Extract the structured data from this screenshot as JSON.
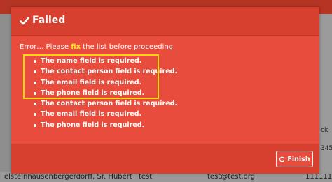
{
  "background": {
    "right_texts": [
      "ck",
      "345",
      "1111"
    ],
    "row": {
      "name": "elsteinhausenbergerdorff, Sr. Hubert",
      "user": "test",
      "email": "test@test.org",
      "phone": "1111111"
    }
  },
  "dialog": {
    "title": "Failed",
    "title_icon": "check-icon",
    "message_before": "Error… Please ",
    "message_highlight": "fix",
    "message_after": " the list before proceeding",
    "errors": [
      "The name field is required.",
      "The contact person field is required.",
      "The email field is required.",
      "The phone field is required.",
      "The contact person field is required.",
      "The email field is required.",
      "The phone field is required."
    ],
    "finish_label": "Finish",
    "finish_icon": "refresh-icon"
  },
  "colors": {
    "dialog_bg": "#e74c3c",
    "header_bg": "#d7402f",
    "highlight": "#f5d90a"
  }
}
